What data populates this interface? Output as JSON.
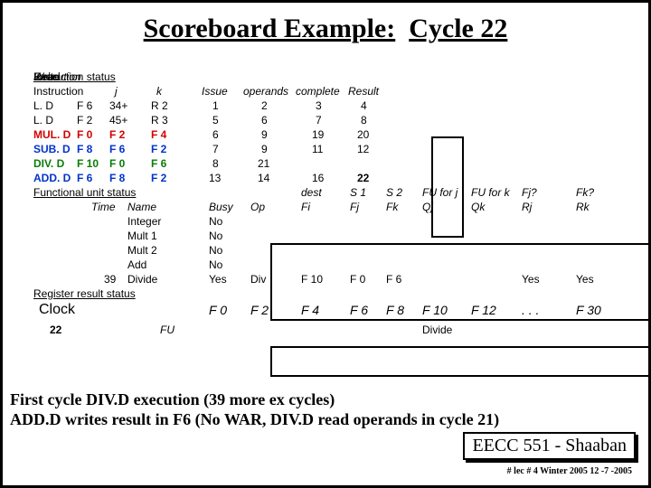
{
  "title_a": "Scoreboard Example:",
  "title_b": "Cycle 22",
  "headers": {
    "instr_status": "Instruction status",
    "instr": "Instruction",
    "j": "j",
    "k": "k",
    "issue": "Issue",
    "read": "Read",
    "operands": "operands",
    "exec": "Execution",
    "complete": "complete",
    "write": "Write",
    "result": "Result",
    "fu_status": "Functional unit status",
    "time": "Time",
    "name": "Name",
    "busy": "Busy",
    "op": "Op",
    "dest": "dest",
    "fi": "Fi",
    "s1": "S 1",
    "fj": "Fj",
    "s2": "S 2",
    "fk": "Fk",
    "fuj": "FU for j",
    "qj": "Qj",
    "fuk": "FU for k",
    "qk": "Qk",
    "fjq": "Fj?",
    "rj": "Rj",
    "fkq": "Fk?",
    "rk": "Rk",
    "reg_status": "Register result status",
    "clock": "Clock",
    "fu": "FU"
  },
  "rows": [
    {
      "op": "L. D",
      "d": "F 6",
      "j": "34+",
      "k": "R 2",
      "is": "1",
      "rd": "2",
      "ex": "3",
      "wr": "4"
    },
    {
      "op": "L. D",
      "d": "F 2",
      "j": "45+",
      "k": "R 3",
      "is": "5",
      "rd": "6",
      "ex": "7",
      "wr": "8"
    },
    {
      "op": "MUL. D",
      "d": "F 0",
      "j": "F 2",
      "k": "F 4",
      "is": "6",
      "rd": "9",
      "ex": "19",
      "wr": "20"
    },
    {
      "op": "SUB. D",
      "d": "F 8",
      "j": "F 6",
      "k": "F 2",
      "is": "7",
      "rd": "9",
      "ex": "11",
      "wr": "12"
    },
    {
      "op": "DIV. D",
      "d": "F 10",
      "j": "F 0",
      "k": "F 6",
      "is": "8",
      "rd": "21",
      "ex": "",
      "wr": ""
    },
    {
      "op": "ADD. D",
      "d": "F 6",
      "j": "F 8",
      "k": "F 2",
      "is": "13",
      "rd": "14",
      "ex": "16",
      "wr": "22"
    }
  ],
  "fu": [
    {
      "t": "",
      "n": "Integer",
      "b": "No"
    },
    {
      "t": "",
      "n": "Mult 1",
      "b": "No"
    },
    {
      "t": "",
      "n": "Mult 2",
      "b": "No"
    },
    {
      "t": "",
      "n": "Add",
      "b": "No"
    },
    {
      "t": "39",
      "n": "Divide",
      "b": "Yes",
      "op": "Div",
      "fi": "F 10",
      "fj": "F 0",
      "fk": "F 6",
      "rj": "Yes",
      "rk": "Yes"
    }
  ],
  "reg": {
    "F0": "F 0",
    "F2": "F 2",
    "F4": "F 4",
    "F6": "F 6",
    "F8": "F 8",
    "F10": "F 10",
    "F12": "F 12",
    "dots": ". . .",
    "F30": "F 30",
    "fu_f10": "Divide"
  },
  "clock_val": "22",
  "notes_l1": "First cycle DIV.D execution (39 more ex cycles)",
  "notes_l2": "ADD.D writes result in F6 (No WAR, DIV.D read operands in cycle 21)",
  "footer": "EECC 551 - Shaaban",
  "footer_sub": "#  lec # 4  Winter 2005   12 -7 -2005"
}
